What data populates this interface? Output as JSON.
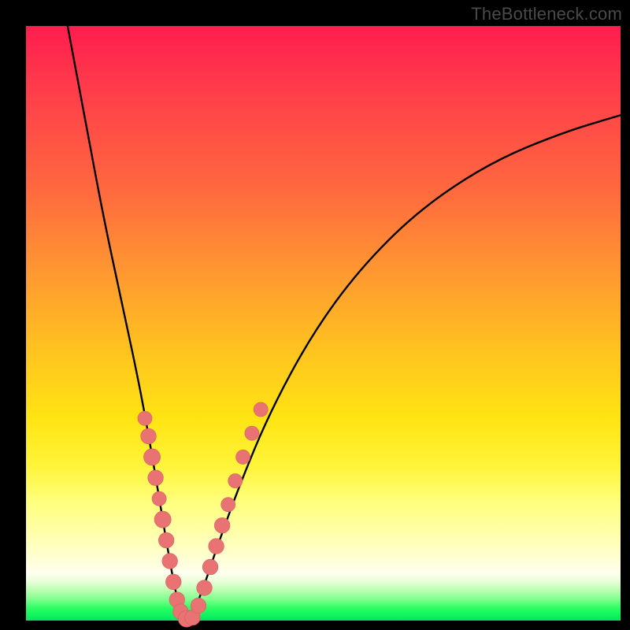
{
  "watermark": "TheBottleneck.com",
  "colors": {
    "curve": "#000000",
    "marker_fill": "#e97373",
    "marker_stroke": "#d45f5f"
  },
  "chart_data": {
    "type": "line",
    "title": "",
    "xlabel": "",
    "ylabel": "",
    "xlim": [
      0,
      100
    ],
    "ylim": [
      0,
      100
    ],
    "grid": false,
    "legend": false,
    "series": [
      {
        "name": "bottleneck-curve",
        "x": [
          7,
          10,
          13,
          16,
          19,
          21,
          22.5,
          24,
          25.5,
          27,
          29,
          32,
          36,
          41,
          48,
          56,
          66,
          78,
          90,
          100
        ],
        "y": [
          100,
          84,
          68,
          54,
          40,
          29,
          20,
          11,
          3,
          0,
          3,
          12,
          23,
          35,
          48,
          59,
          69,
          77,
          82,
          85
        ]
      }
    ],
    "markers": {
      "name": "highlighted-points",
      "points": [
        {
          "x": 20.0,
          "y": 34.0,
          "r": 1.2
        },
        {
          "x": 20.6,
          "y": 31.0,
          "r": 1.3
        },
        {
          "x": 21.2,
          "y": 27.5,
          "r": 1.4
        },
        {
          "x": 21.8,
          "y": 24.0,
          "r": 1.3
        },
        {
          "x": 22.4,
          "y": 20.5,
          "r": 1.2
        },
        {
          "x": 23.0,
          "y": 17.0,
          "r": 1.4
        },
        {
          "x": 23.6,
          "y": 13.5,
          "r": 1.3
        },
        {
          "x": 24.2,
          "y": 10.0,
          "r": 1.3
        },
        {
          "x": 24.8,
          "y": 6.5,
          "r": 1.3
        },
        {
          "x": 25.4,
          "y": 3.5,
          "r": 1.3
        },
        {
          "x": 26.0,
          "y": 1.5,
          "r": 1.3
        },
        {
          "x": 27.0,
          "y": 0.3,
          "r": 1.4
        },
        {
          "x": 28.0,
          "y": 0.5,
          "r": 1.3
        },
        {
          "x": 29.0,
          "y": 2.5,
          "r": 1.3
        },
        {
          "x": 30.0,
          "y": 5.5,
          "r": 1.3
        },
        {
          "x": 31.0,
          "y": 9.0,
          "r": 1.3
        },
        {
          "x": 32.0,
          "y": 12.5,
          "r": 1.3
        },
        {
          "x": 33.0,
          "y": 16.0,
          "r": 1.3
        },
        {
          "x": 34.0,
          "y": 19.5,
          "r": 1.2
        },
        {
          "x": 35.2,
          "y": 23.5,
          "r": 1.2
        },
        {
          "x": 36.5,
          "y": 27.5,
          "r": 1.2
        },
        {
          "x": 38.0,
          "y": 31.5,
          "r": 1.2
        },
        {
          "x": 39.5,
          "y": 35.5,
          "r": 1.2
        }
      ]
    }
  }
}
